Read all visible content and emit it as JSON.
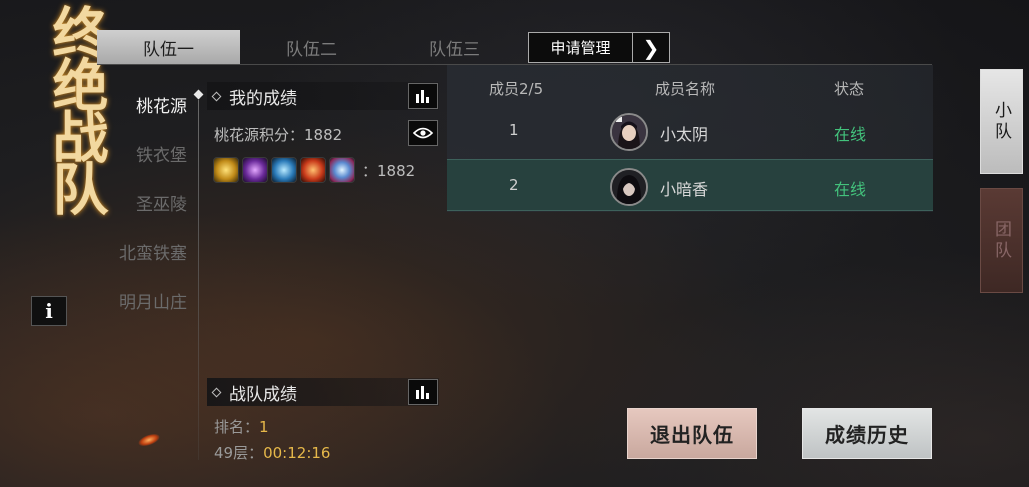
{
  "game_title": "终绝战队",
  "info_button": "i",
  "tabs": [
    {
      "label": "队伍一",
      "active": true
    },
    {
      "label": "队伍二",
      "active": false
    },
    {
      "label": "队伍三",
      "active": false
    }
  ],
  "apply_button": {
    "label": "申请管理",
    "arrow": "❯"
  },
  "regions": [
    {
      "label": "桃花源",
      "active": true
    },
    {
      "label": "铁衣堡",
      "active": false
    },
    {
      "label": "圣巫陵",
      "active": false
    },
    {
      "label": "北蛮铁塞",
      "active": false
    },
    {
      "label": "明月山庄",
      "active": false
    }
  ],
  "my_score": {
    "title": "我的成绩",
    "points_line": "桃花源积分：1882",
    "skills_total": "：1882",
    "skills": [
      "gold-star-skill-icon",
      "purple-blade-skill-icon",
      "blue-wave-skill-icon",
      "fire-orb-skill-icon",
      "ice-flame-skill-icon"
    ]
  },
  "team_score": {
    "title": "战队成绩",
    "rank_label": "排名：",
    "rank_value": "1",
    "floor_label": "49层：",
    "floor_time": "00:12:16"
  },
  "members": {
    "headers": {
      "count": "成员2/5",
      "name": "成员名称",
      "status": "状态"
    },
    "rows": [
      {
        "num": "1",
        "name": "小太阴",
        "status": "在线",
        "highlight": false
      },
      {
        "num": "2",
        "name": "小暗香",
        "status": "在线",
        "highlight": true
      }
    ]
  },
  "side_tabs": [
    {
      "label": "小队",
      "active": true
    },
    {
      "label": "团队",
      "active": false
    }
  ],
  "buttons": {
    "exit": "退出队伍",
    "history": "成绩历史"
  },
  "colors": {
    "online": "#43c27c",
    "time": "#e6b84a",
    "title_glow": "#c88a2a",
    "highlight_row": "#27413e"
  }
}
